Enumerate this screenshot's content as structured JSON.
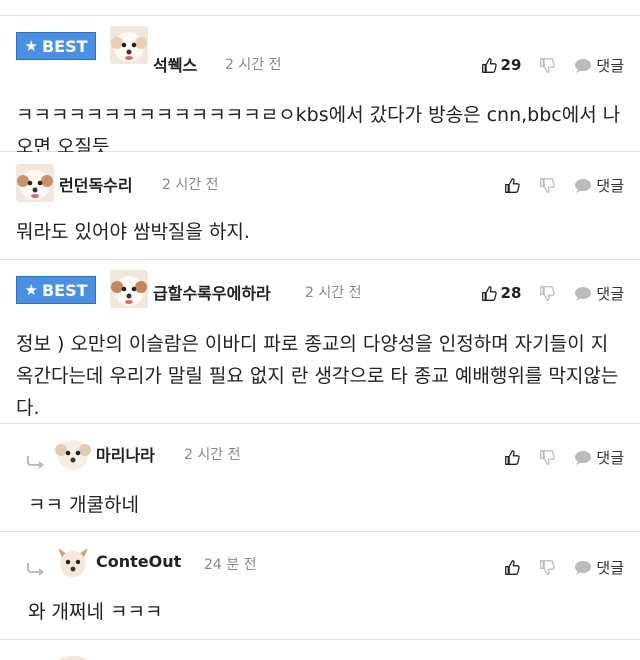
{
  "best_label": "BEST",
  "comments": [
    {
      "best": true,
      "author": "석쒝스",
      "time": "2 시간 전",
      "likes": "29",
      "reply_label": "댓글",
      "text": "ㅋㅋㅋㅋㅋㅋㅋㅋㅋㅋㅋㅋㅋㅋㄹㅇkbs에서 갔다가 방송은 cnn,bbc에서 나오면 오질듯"
    },
    {
      "best": false,
      "author": "런던독수리",
      "time": "2 시간 전",
      "likes": "",
      "reply_label": "댓글",
      "text": "뭐라도 있어야 쌈박질을 하지."
    },
    {
      "best": true,
      "author": "급할수록우에하라",
      "time": "2 시간 전",
      "likes": "28",
      "reply_label": "댓글",
      "text": "정보 ) 오만의 이슬람은 이바디 파로 종교의 다양성을 인정하며 자기들이 지옥간다는데 우리가 말릴 필요 없지 란 생각으로 타 종교 예배행위를 막지않는다."
    },
    {
      "best": false,
      "author": "마리나라",
      "time": "2 시간 전",
      "likes": "",
      "reply_label": "댓글",
      "text": "ㅋㅋ 개쿨하네"
    },
    {
      "best": false,
      "author": "ConteOut",
      "time": "24 분 전",
      "likes": "",
      "reply_label": "댓글",
      "text": "와 개쩌네 ㅋㅋㅋ"
    }
  ],
  "icons": {
    "like": "thumbs-up-icon",
    "dislike": "thumbs-down-icon",
    "reply": "speech-bubble-icon",
    "reply_indicator": "reply-arrow-icon",
    "best_star": "star-icon"
  },
  "colors": {
    "best_badge": "#4a90e2",
    "time_text": "#888888",
    "divider": "#e3e3e3"
  }
}
